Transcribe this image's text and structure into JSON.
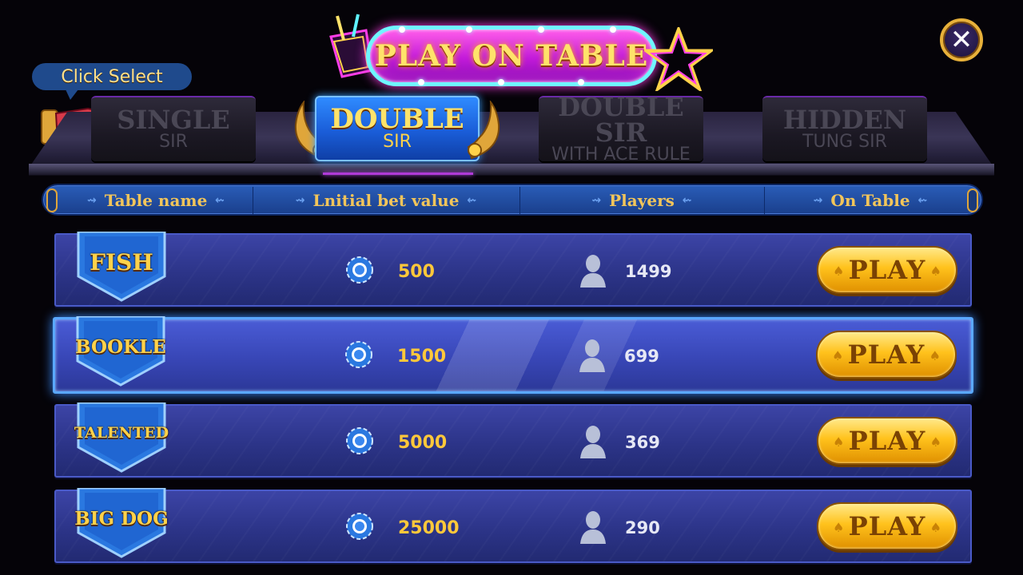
{
  "title": {
    "text": "PLAY ON TABLE"
  },
  "close_button": {
    "icon": "close-icon",
    "glyph": "✕"
  },
  "hint": {
    "text": "Click Select"
  },
  "tabs": [
    {
      "line1": "SINGLE",
      "line2": "SIR",
      "active": false
    },
    {
      "line1": "DOUBLE",
      "line2": "SIR",
      "active": true
    },
    {
      "line1": "DOUBLE SIR",
      "line2": "WITH ACE RULE",
      "active": false
    },
    {
      "line1": "HIDDEN",
      "line2": "TUNG SIR",
      "active": false
    }
  ],
  "columns": [
    {
      "label": "Table name"
    },
    {
      "label": "Lnitial bet value"
    },
    {
      "label": "Players"
    },
    {
      "label": "On Table"
    }
  ],
  "rows": [
    {
      "name": "FISH",
      "bet": "500",
      "players": "1499",
      "action": "PLAY",
      "selected": false
    },
    {
      "name": "BOOKLE",
      "bet": "1500",
      "players": "699",
      "action": "PLAY",
      "selected": true
    },
    {
      "name": "TALENTED",
      "bet": "5000",
      "players": "369",
      "action": "PLAY",
      "selected": false
    },
    {
      "name": "BIG DOG",
      "bet": "25000",
      "players": "290",
      "action": "PLAY",
      "selected": false
    }
  ],
  "colors": {
    "accent_gold": "#ffc83a",
    "active_tab": "#1a5dd8",
    "row_blue": "#2c3488",
    "selected_glow": "#3a8cff",
    "title_magenta": "#c21ad9"
  }
}
